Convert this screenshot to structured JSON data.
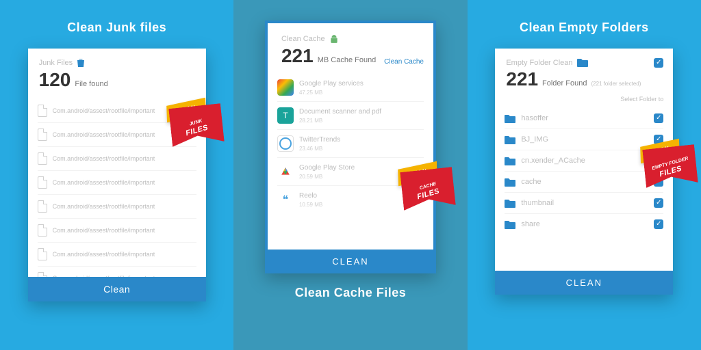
{
  "panel1": {
    "title": "Clean Junk files",
    "badge": {
      "top": "CLEAN",
      "l1": "JUNK",
      "l2": "FILES"
    },
    "header": {
      "sub": "Junk Files",
      "count": "120",
      "suffix": "File found"
    },
    "rows": [
      "Com.android/assest/rootfile/important",
      "Com.android/assest/rootfile/important",
      "Com.android/assest/rootfile/important",
      "Com.android/assest/rootfile/important",
      "Com.android/assest/rootfile/important",
      "Com.android/assest/rootfile/important",
      "Com.android/assest/rootfile/important",
      "Com.android/assest/rootfile/important"
    ],
    "button": "Clean"
  },
  "panel2": {
    "title": "Clean Cache Files",
    "badge": {
      "top": "CLEAN",
      "l1": "CACHE",
      "l2": "FILES"
    },
    "header": {
      "sub": "Clean Cache",
      "count": "221",
      "suffix": "MB Cache Found",
      "link": "Clean Cache"
    },
    "apps": [
      {
        "name": "Google Play services",
        "size": "47.25 MB",
        "iconClass": "ai-play"
      },
      {
        "name": "Document scanner and pdf",
        "size": "28.21 MB",
        "iconClass": "ai-doc",
        "glyph": "T"
      },
      {
        "name": "TwitterTrends",
        "size": "23.46 MB",
        "iconClass": "ai-tw"
      },
      {
        "name": "Google Play Store",
        "size": "20.59 MB",
        "iconClass": "ai-store"
      },
      {
        "name": "Reelo",
        "size": "10.59 MB",
        "iconClass": "ai-reelo",
        "glyph": "❝"
      }
    ],
    "button": "CLEAN"
  },
  "panel3": {
    "title": "Clean Empty Folders",
    "badge": {
      "top": "CLEAN",
      "l1": "EMPTY FOLDER",
      "l2": "FILES"
    },
    "header": {
      "sub": "Empty Folder Clean",
      "count": "221",
      "suffix": "Folder Found",
      "note": "(221 folder selected)",
      "hint": "Select Folder to"
    },
    "folders": [
      "hasoffer",
      "BJ_IMG",
      "cn.xender_ACache",
      "cache",
      "thumbnail",
      "share"
    ],
    "button": "CLEAN"
  }
}
